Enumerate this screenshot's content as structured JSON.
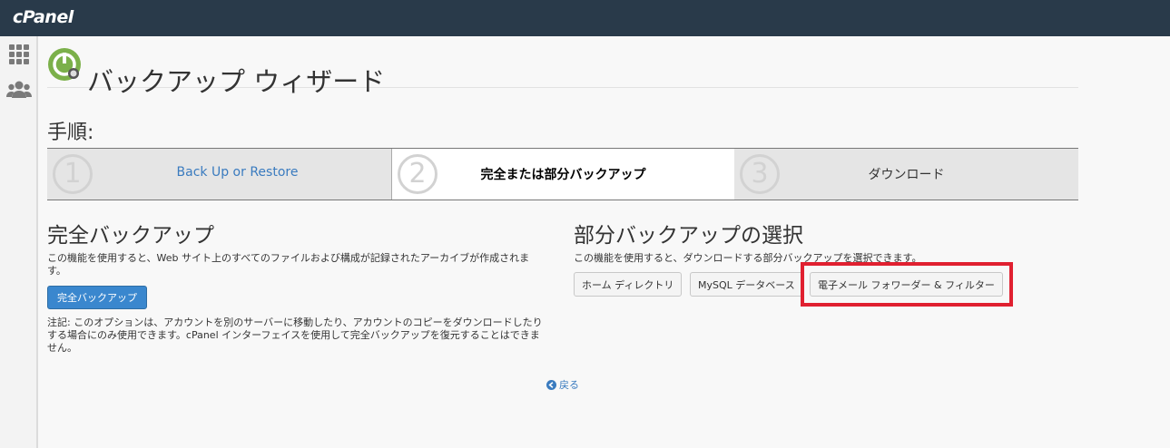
{
  "topbar": {
    "logo": "cPanel"
  },
  "sidebar": {
    "icons": [
      "grid-icon",
      "users-icon"
    ]
  },
  "page": {
    "title": "バックアップ ウィザード"
  },
  "steps": {
    "heading": "手順:",
    "items": [
      {
        "number": "①",
        "label": "Back Up or Restore",
        "state": "link"
      },
      {
        "number": "②",
        "label": "完全または部分バックアップ",
        "state": "active"
      },
      {
        "number": "③",
        "label": "ダウンロード",
        "state": "pending"
      }
    ]
  },
  "full_backup": {
    "title": "完全バックアップ",
    "description_line1": "この機能を使用すると、Web サイト上のすべてのファイルおよび構成が記録されたアーカイブが作成されま",
    "description_line2": "す。",
    "button": "完全バックアップ",
    "note_line1": "注記: このオプションは、アカウントを別のサーバーに移動したり、アカウントのコピーをダウンロードしたり",
    "note_line2": "する場合にのみ使用できます。cPanel インターフェイスを使用して完全バックアップを復元することはできま",
    "note_line3": "せん。"
  },
  "partial_backup": {
    "title": "部分バックアップの選択",
    "description": "この機能を使用すると、ダウンロードする部分バックアップを選択できます。",
    "buttons": [
      "ホーム ディレクトリ",
      "MySQL データベース",
      "電子メール フォワーダー & フィルター"
    ]
  },
  "back_link": "戻る",
  "colors": {
    "topbar": "#293a4a",
    "primary_button": "#3a87ce",
    "link": "#3a7bbf",
    "highlight": "#e02030"
  }
}
